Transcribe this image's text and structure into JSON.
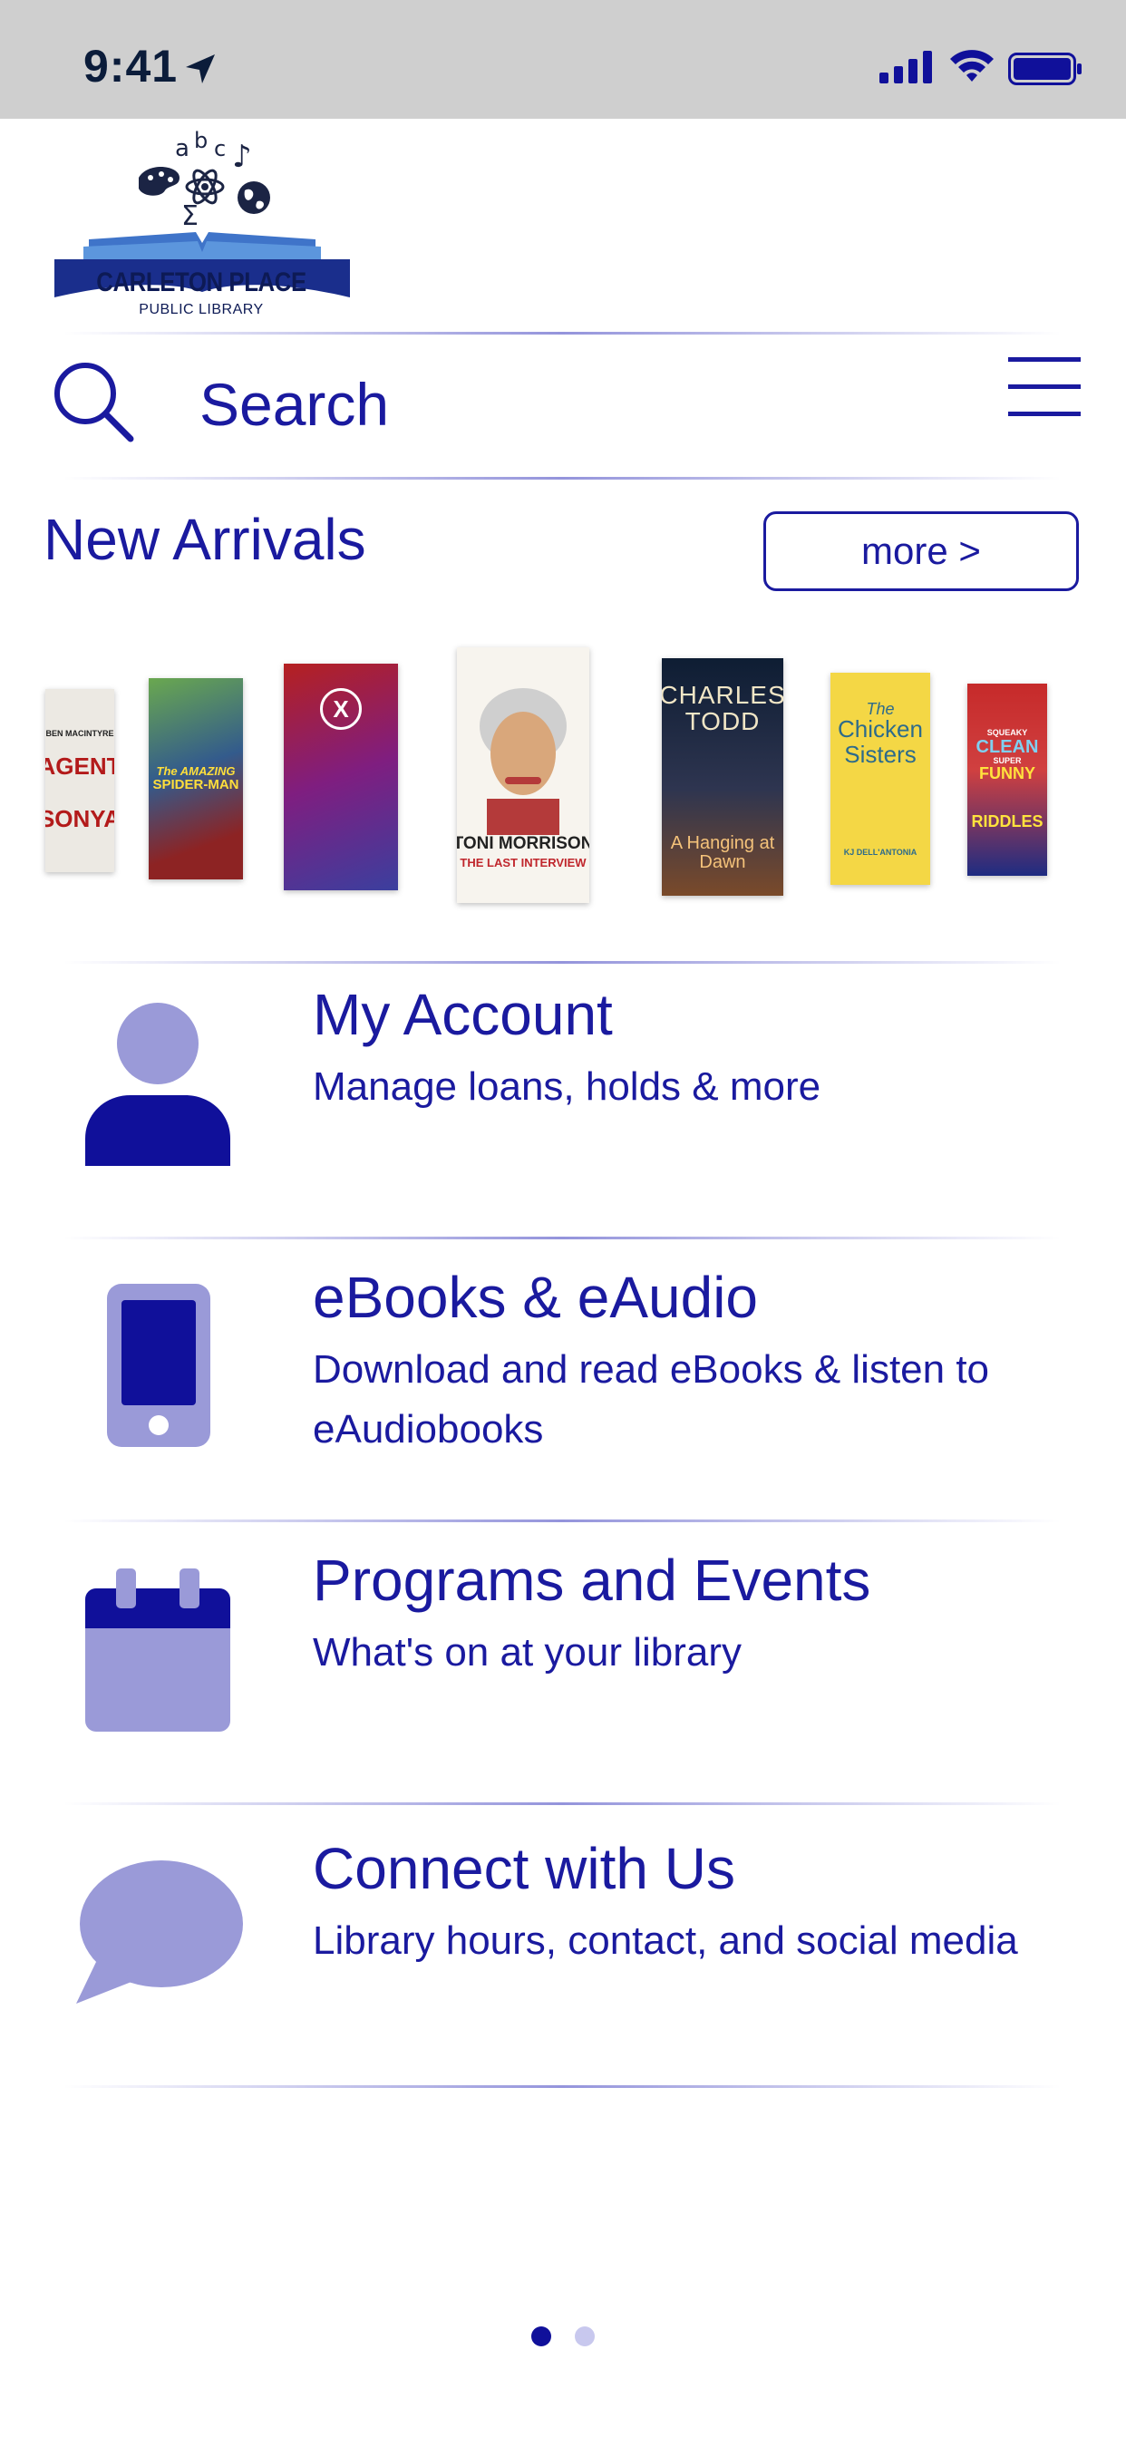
{
  "status_bar": {
    "time": "9:41",
    "icons": [
      "location-arrow-icon",
      "cellular-signal-icon",
      "wifi-icon",
      "battery-icon"
    ]
  },
  "logo": {
    "name": "CARLETON PLACE",
    "subtitle": "PUBLIC LIBRARY",
    "glyphs": [
      "a",
      "b",
      "c",
      "Σ",
      "♪"
    ]
  },
  "search": {
    "label": "Search",
    "icons": [
      "search-icon",
      "hamburger-menu-icon"
    ]
  },
  "new_arrivals": {
    "title": "New Arrivals",
    "more_label": "more >",
    "books": [
      {
        "cover_lines": [
          "BEN MACINTYRE",
          "AGENT",
          "SONYA"
        ]
      },
      {
        "cover_lines": [
          "The AMAZING",
          "SPIDER-MAN"
        ]
      },
      {
        "cover_lines": [
          "X"
        ]
      },
      {
        "cover_lines": [
          "TONI MORRISON",
          "THE LAST INTERVIEW"
        ]
      },
      {
        "cover_lines": [
          "CHARLES",
          "TODD",
          "A Hanging at Dawn"
        ]
      },
      {
        "cover_lines": [
          "The",
          "Chicken",
          "Sisters",
          "KJ DELL'ANTONIA"
        ]
      },
      {
        "cover_lines": [
          "SQUEAKY",
          "CLEAN",
          "SUPER",
          "FUNNY",
          "RIDDLES"
        ]
      }
    ]
  },
  "menu": [
    {
      "title": "My Account",
      "description": "Manage loans, holds & more",
      "icon": "person-icon"
    },
    {
      "title": "eBooks & eAudio",
      "description": "Download and read eBooks & listen to eAudiobooks",
      "icon": "phone-icon"
    },
    {
      "title": "Programs and Events",
      "description": "What's on at your library",
      "icon": "calendar-icon"
    },
    {
      "title": "Connect with Us",
      "description": "Library hours, contact, and social media",
      "icon": "chat-bubble-icon"
    }
  ],
  "pagination": {
    "current_page": 1,
    "page_count": 2
  },
  "colors": {
    "primary": "#1a1a9f",
    "icon_light": "#9a9ad8",
    "icon_dark": "#10109a",
    "status_bar_bg": "#cfcfcf"
  }
}
